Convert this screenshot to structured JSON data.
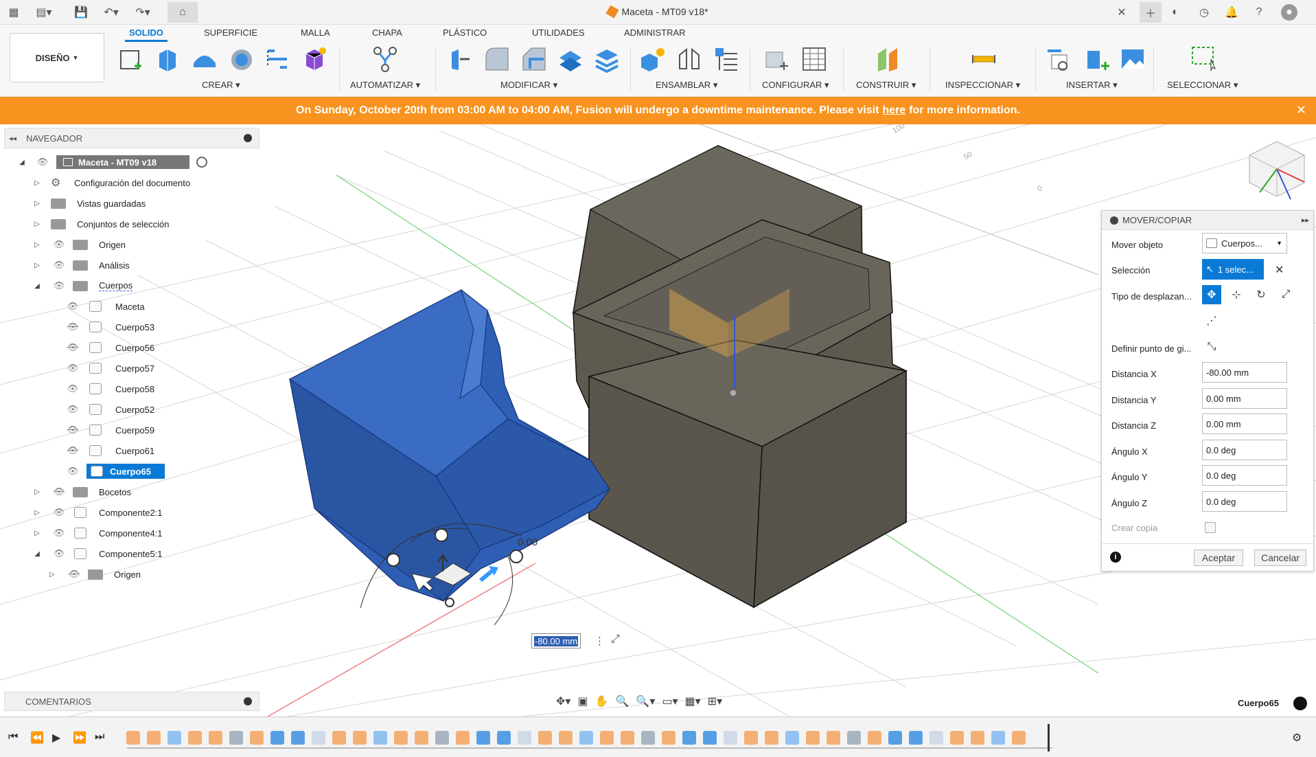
{
  "titlebar": {
    "doc_title": "Maceta - MT09 v18*",
    "close_glyph": "✕"
  },
  "toolbar": {
    "workspace_label": "DISEÑO",
    "tabs": [
      {
        "label": "SOLIDO",
        "active": true
      },
      {
        "label": "SUPERFICIE"
      },
      {
        "label": "MALLA"
      },
      {
        "label": "CHAPA"
      },
      {
        "label": "PLÁSTICO"
      },
      {
        "label": "UTILIDADES"
      },
      {
        "label": "ADMINISTRAR"
      }
    ],
    "groups": {
      "crear": "CREAR",
      "automatizar": "AUTOMATIZAR",
      "modificar": "MODIFICAR",
      "ensamblar": "ENSAMBLAR",
      "configurar": "CONFIGURAR",
      "construir": "CONSTRUIR",
      "inspeccionar": "INSPECCIONAR",
      "insertar": "INSERTAR",
      "seleccionar": "SELECCIONAR"
    }
  },
  "banner": {
    "text_before": "On Sunday, October 20th from 03:00 AM to 04:00 AM, Fusion will undergo a downtime maintenance. Please visit",
    "link": "here",
    "text_after": "for more information.",
    "close_glyph": "✕",
    "color": "#f7931e"
  },
  "navigator": {
    "title": "NAVEGADOR",
    "root": "Maceta - MT09 v18",
    "items": [
      "Configuración del documento",
      "Vistas guardadas",
      "Conjuntos de selección",
      "Origen",
      "Análisis",
      "Cuerpos"
    ],
    "bodies": [
      "Maceta",
      "Cuerpo53",
      "Cuerpo56",
      "Cuerpo57",
      "Cuerpo58",
      "Cuerpo52",
      "Cuerpo59",
      "Cuerpo61",
      "Cuerpo65"
    ],
    "after": [
      "Bocetos",
      "Componente2:1",
      "Componente4:1",
      "Componente5:1",
      "Origen"
    ]
  },
  "comments": {
    "title": "COMENTARIOS"
  },
  "panel": {
    "title": "MOVER/COPIAR",
    "labels": {
      "mover": "Mover objeto",
      "seleccion": "Selección",
      "tipo": "Tipo de desplazan...",
      "pivote": "Definir punto de gi...",
      "dx": "Distancia X",
      "dy": "Distancia Y",
      "dz": "Distancia Z",
      "ax": "Ángulo X",
      "ay": "Ángulo Y",
      "az": "Ángulo Z",
      "copia": "Crear copia"
    },
    "values": {
      "mover": "Cuerpos...",
      "seleccion": "1 selec...",
      "dx": "-80.00 mm",
      "dy": "0.00 mm",
      "dz": "0.00 mm",
      "ax": "0.0 deg",
      "ay": "0.0 deg",
      "az": "0.0 deg"
    },
    "ok": "Aceptar",
    "cancel": "Cancelar"
  },
  "viewport": {
    "dim_input": "-80.00 mm",
    "dim_label": "0.00",
    "grid_labels": [
      "100",
      "50",
      "0"
    ],
    "selected_label": "Cuerpo65",
    "colors": {
      "selected_body": "#2f5fb4",
      "body": "#5f5a50",
      "accent": "#0a7ad6"
    }
  }
}
